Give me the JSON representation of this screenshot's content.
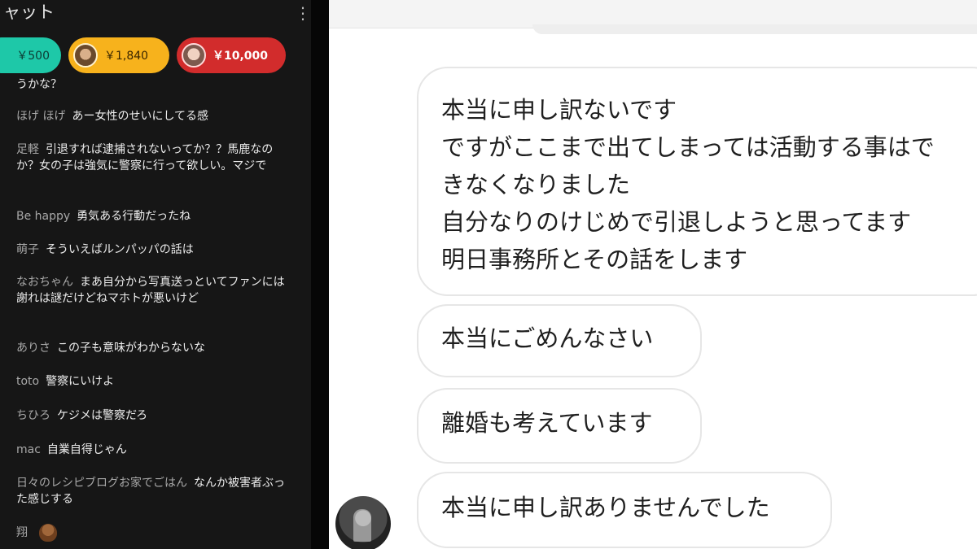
{
  "chat": {
    "header_title": "ャット",
    "menu_icon": "vertical-dots-icon",
    "superchats": [
      {
        "amount": "￥500",
        "color": "#1ec8a8"
      },
      {
        "amount": "￥1,840",
        "color": "#f7b21c"
      },
      {
        "amount": "￥10,000",
        "color": "#d22c2c"
      }
    ],
    "messages": [
      {
        "author": "",
        "text": "うかな？"
      },
      {
        "author": "ほげ ほげ",
        "text": "あー女性のせいにしてる感"
      },
      {
        "author": "足軽",
        "text": "引退すれば逮捕されないってか？？馬鹿なのか？女の子は強気に警察に行って欲しい。マジで"
      },
      {
        "author": "Be happy",
        "text": "勇気ある行動だったね"
      },
      {
        "author": "萌子",
        "text": "そういえばルンパッパの話は"
      },
      {
        "author": "なおちゃん",
        "text": "まあ自分から写真送っといてファンには謝れは謎だけどねマホトが悪いけど"
      },
      {
        "author": "ありさ",
        "text": "この子も意味がわからないな"
      },
      {
        "author": "toto",
        "text": "警察にいけよ"
      },
      {
        "author": "ちひろ",
        "text": "ケジメは警察だろ"
      },
      {
        "author": "mac",
        "text": "自業自得じゃん"
      },
      {
        "author": "日々のレシピブログお家でごはん",
        "text": "なんか被害者ぶった感じする"
      },
      {
        "author": "翔",
        "text": ""
      }
    ]
  },
  "conversation": {
    "bubble1_lines": [
      "本当に申し訳ないです",
      "ですがここまで出てしまっては活動する事はで",
      "きなくなりました",
      "自分なりのけじめで引退しようと思ってます",
      "明日事務所とその話をします"
    ],
    "bubble2": "本当にごめんなさい",
    "bubble3": "離婚も考えています",
    "bubble4": "本当に申し訳ありませんでした"
  }
}
